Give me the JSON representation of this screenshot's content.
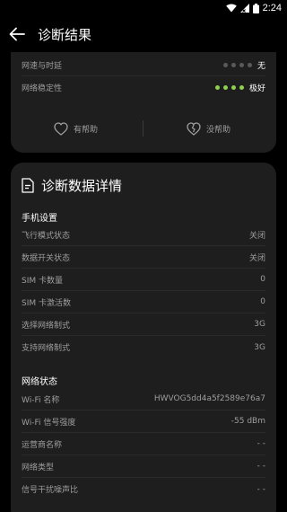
{
  "status_bar": {
    "time": "2:24"
  },
  "app_bar": {
    "title": "诊断结果"
  },
  "summary": {
    "rows": [
      {
        "label": "网速与时延",
        "value": "无"
      },
      {
        "label": "网络稳定性",
        "value": "极好"
      }
    ],
    "helpful_label": "有帮助",
    "unhelpful_label": "没帮助"
  },
  "details": {
    "title": "诊断数据详情",
    "phone_settings": {
      "title": "手机设置",
      "rows": [
        {
          "label": "飞行模式状态",
          "value": "关闭"
        },
        {
          "label": "数据开关状态",
          "value": "关闭"
        },
        {
          "label": "SIM 卡数量",
          "value": "0"
        },
        {
          "label": "SIM 卡激活数",
          "value": "0"
        },
        {
          "label": "选择网络制式",
          "value": "3G"
        },
        {
          "label": "支持网络制式",
          "value": "3G"
        }
      ]
    },
    "network_status": {
      "title": "网络状态",
      "rows": [
        {
          "label": "Wi-Fi 名称",
          "value": "HWVOG5dd4a5f2589e76a7"
        },
        {
          "label": "Wi-Fi 信号强度",
          "value": "-55 dBm"
        },
        {
          "label": "运营商名称",
          "value": "- -"
        },
        {
          "label": "网络类型",
          "value": "- -"
        },
        {
          "label": "信号干扰噪声比",
          "value": "- -"
        }
      ]
    }
  },
  "colors": {
    "background": "#000000",
    "card": "#1e1e1e",
    "good_dot": "#8fd14f",
    "inactive_dot": "#5a5a5a"
  }
}
